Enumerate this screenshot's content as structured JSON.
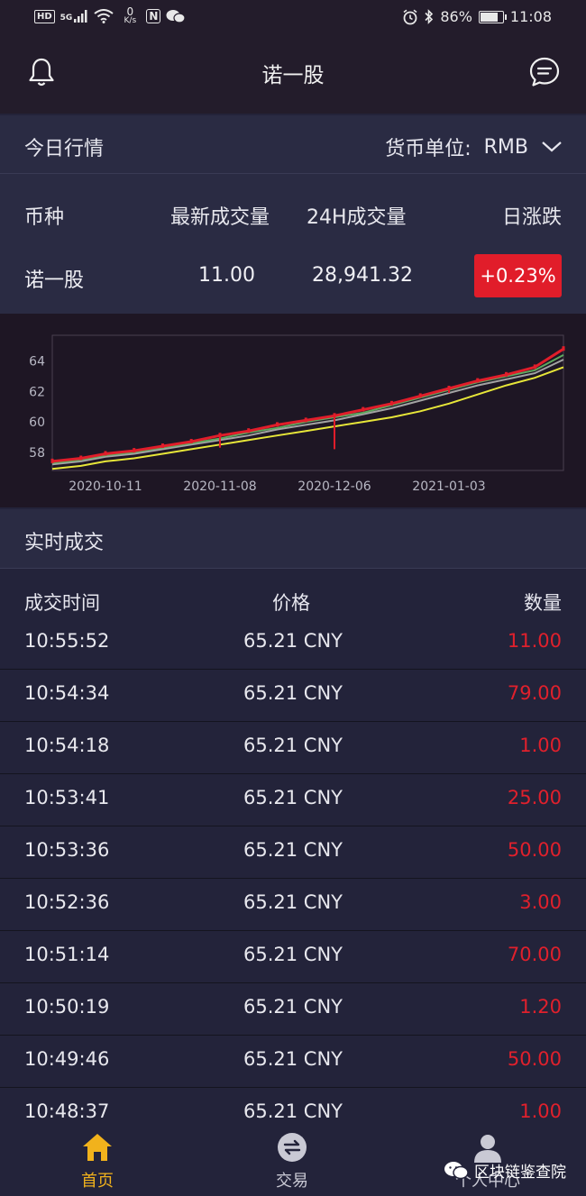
{
  "status_bar": {
    "hd": "HD",
    "signal": "5G",
    "net_speed_value": "0",
    "net_speed_unit": "K/s",
    "nfc": "N",
    "battery": "86%",
    "battery_level": 0.86,
    "time": "11:08"
  },
  "header": {
    "title": "诺一股"
  },
  "market": {
    "title": "今日行情",
    "currency_label": "货币单位:",
    "currency_value": "RMB"
  },
  "quote": {
    "headers": [
      "币种",
      "最新成交量",
      "24H成交量",
      "日涨跌"
    ],
    "coin": "诺一股",
    "latest_volume": "11.00",
    "volume_24h": "28,941.32",
    "change": "+0.23%"
  },
  "colors": {
    "up": "#e11d2a",
    "accent": "#f1b21c",
    "ma_yellow": "#e7e639",
    "ma_green": "#5fa860",
    "ma_gray": "#a3a3a3"
  },
  "chart_data": {
    "type": "line",
    "x": [
      "2020-09-28",
      "2020-10-05",
      "2020-10-11",
      "2020-10-18",
      "2020-10-25",
      "2020-11-01",
      "2020-11-08",
      "2020-11-15",
      "2020-11-22",
      "2020-11-29",
      "2020-12-06",
      "2020-12-13",
      "2020-12-20",
      "2020-12-27",
      "2021-01-03",
      "2021-01-10",
      "2021-01-17",
      "2021-01-24",
      "2021-01-31"
    ],
    "x_ticks": [
      "2020-10-11",
      "2020-11-08",
      "2020-12-06",
      "2021-01-03"
    ],
    "y_ticks": [
      58,
      60,
      62,
      64
    ],
    "ylim": [
      56.8,
      65.7
    ],
    "series": [
      {
        "values": [
          57.4,
          57.6,
          57.9,
          58.1,
          58.4,
          58.7,
          59.1,
          59.4,
          59.8,
          60.1,
          60.4,
          60.8,
          61.2,
          61.7,
          62.2,
          62.7,
          63.1,
          63.6,
          64.8
        ],
        "color": "#e11d2a"
      },
      {
        "values": [
          57.3,
          57.5,
          57.8,
          58.0,
          58.3,
          58.6,
          58.9,
          59.3,
          59.6,
          60.0,
          60.3,
          60.6,
          61.1,
          61.6,
          62.1,
          62.6,
          63.0,
          63.4,
          64.4
        ],
        "color": "#5fa860"
      },
      {
        "values": [
          57.2,
          57.4,
          57.7,
          57.9,
          58.2,
          58.5,
          58.8,
          59.1,
          59.5,
          59.8,
          60.1,
          60.5,
          60.9,
          61.4,
          61.9,
          62.4,
          62.8,
          63.2,
          64.1
        ],
        "color": "#a3a3a3"
      },
      {
        "values": [
          56.9,
          57.1,
          57.4,
          57.6,
          57.9,
          58.2,
          58.5,
          58.8,
          59.1,
          59.4,
          59.7,
          60.0,
          60.3,
          60.7,
          61.2,
          61.8,
          62.4,
          62.9,
          63.6
        ],
        "color": "#e7e639"
      }
    ],
    "spikes": [
      {
        "x": "2020-11-08",
        "low": 58.3
      },
      {
        "x": "2020-12-06",
        "low": 58.2
      },
      {
        "x": "2021-01-03",
        "low": 61.9
      }
    ],
    "grid": false,
    "title": "",
    "xlabel": "",
    "ylabel": ""
  },
  "trades": {
    "title": "实时成交",
    "columns": [
      "成交时间",
      "价格",
      "数量"
    ],
    "rows": [
      {
        "time": "10:55:52",
        "price": "65.21 CNY",
        "qty": "11.00"
      },
      {
        "time": "10:54:34",
        "price": "65.21 CNY",
        "qty": "79.00"
      },
      {
        "time": "10:54:18",
        "price": "65.21 CNY",
        "qty": "1.00"
      },
      {
        "time": "10:53:41",
        "price": "65.21 CNY",
        "qty": "25.00"
      },
      {
        "time": "10:53:36",
        "price": "65.21 CNY",
        "qty": "50.00"
      },
      {
        "time": "10:52:36",
        "price": "65.21 CNY",
        "qty": "3.00"
      },
      {
        "time": "10:51:14",
        "price": "65.21 CNY",
        "qty": "70.00"
      },
      {
        "time": "10:50:19",
        "price": "65.21 CNY",
        "qty": "1.20"
      },
      {
        "time": "10:49:46",
        "price": "65.21 CNY",
        "qty": "50.00"
      },
      {
        "time": "10:48:37",
        "price": "65.21 CNY",
        "qty": "1.00"
      }
    ]
  },
  "tabs": [
    {
      "label": "首页",
      "icon": "home-icon",
      "active": true
    },
    {
      "label": "交易",
      "icon": "exchange-icon",
      "active": false
    },
    {
      "label": "个人中心",
      "icon": "user-icon",
      "active": false
    }
  ],
  "watermark": {
    "text": "区块链鉴查院",
    "icon": "wechat-icon"
  }
}
